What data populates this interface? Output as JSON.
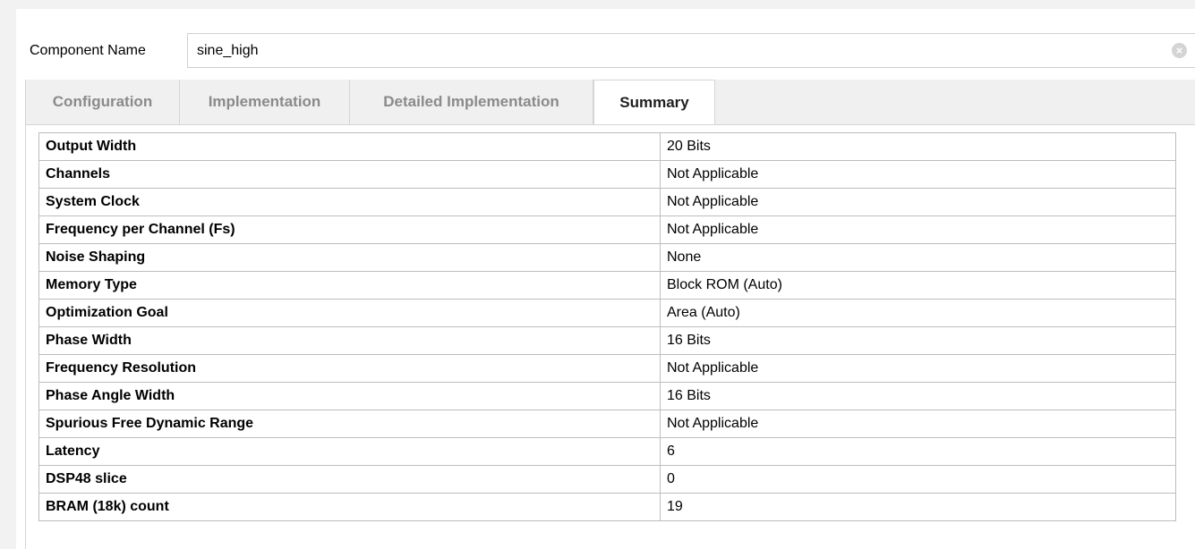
{
  "component": {
    "label": "Component Name",
    "value": "sine_high"
  },
  "icons": {
    "clear": "clear-icon"
  },
  "tabs": [
    {
      "label": "Configuration",
      "active": false
    },
    {
      "label": "Implementation",
      "active": false
    },
    {
      "label": "Detailed Implementation",
      "active": false
    },
    {
      "label": "Summary",
      "active": true
    }
  ],
  "summary": {
    "rows": [
      {
        "label": "Output Width",
        "value": "20 Bits"
      },
      {
        "label": "Channels",
        "value": "Not Applicable"
      },
      {
        "label": "System Clock",
        "value": "Not Applicable"
      },
      {
        "label": "Frequency per Channel (Fs)",
        "value": "Not Applicable"
      },
      {
        "label": "Noise Shaping",
        "value": "None"
      },
      {
        "label": "Memory Type",
        "value": "Block ROM (Auto)"
      },
      {
        "label": "Optimization Goal",
        "value": "Area (Auto)"
      },
      {
        "label": "Phase Width",
        "value": "16 Bits"
      },
      {
        "label": "Frequency Resolution",
        "value": "Not Applicable"
      },
      {
        "label": "Phase Angle Width",
        "value": "16 Bits"
      },
      {
        "label": "Spurious Free Dynamic Range",
        "value": "Not Applicable"
      },
      {
        "label": "Latency",
        "value": "6"
      },
      {
        "label": "DSP48 slice",
        "value": "0"
      },
      {
        "label": "BRAM (18k) count",
        "value": "19"
      }
    ]
  }
}
